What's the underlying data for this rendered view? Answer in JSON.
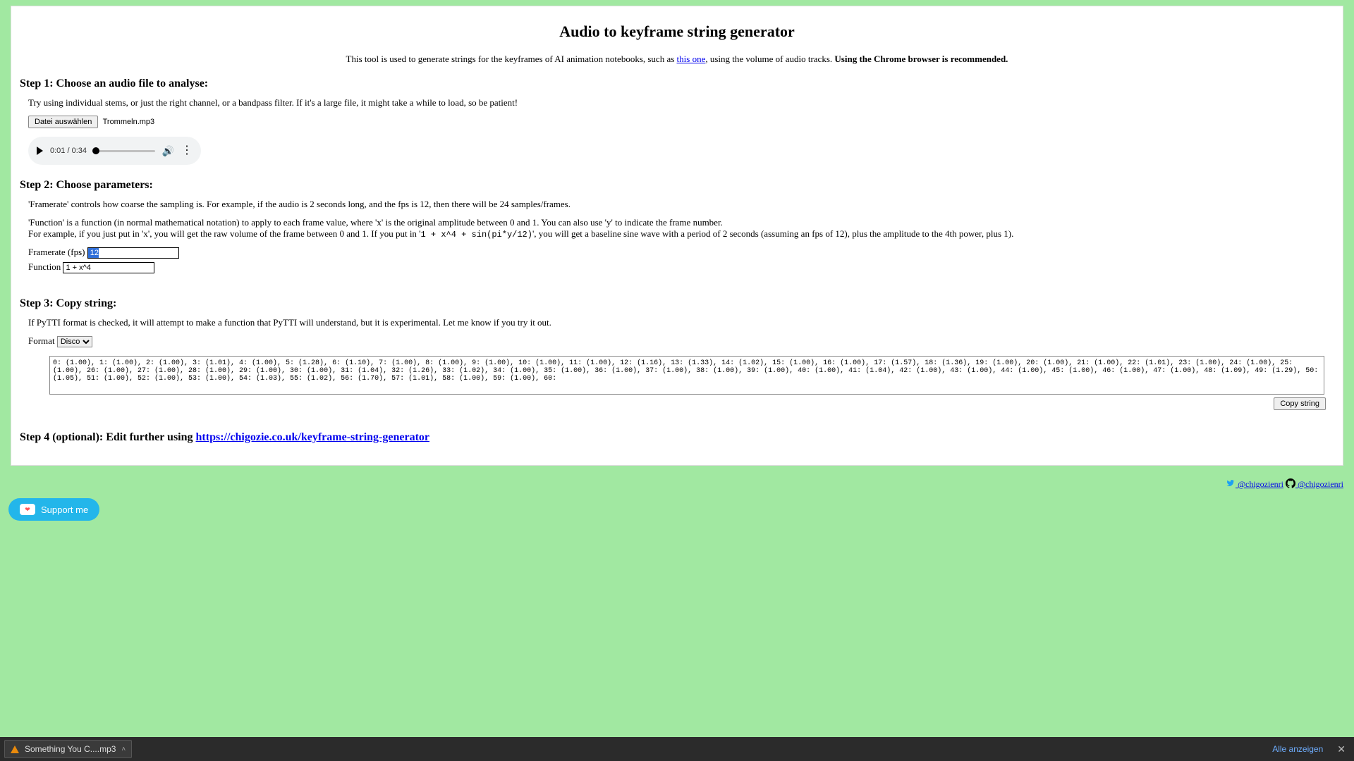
{
  "title": "Audio to keyframe string generator",
  "subtitle_pre": "This tool is used to generate strings for the keyframes of AI animation notebooks, such as ",
  "subtitle_link": "this one",
  "subtitle_post": ", using the volume of audio tracks. ",
  "subtitle_bold": "Using the Chrome browser is recommended.",
  "step1": {
    "heading": "Step 1: Choose an audio file to analyse:",
    "note": "Try using individual stems, or just the right channel, or a bandpass filter. If it's a large file, it might take a while to load, so be patient!",
    "file_button": "Datei auswählen",
    "file_name": "Trommeln.mp3",
    "audio_time": "0:01 / 0:34"
  },
  "step2": {
    "heading": "Step 2: Choose parameters:",
    "p1": "'Framerate' controls how coarse the sampling is. For example, if the audio is 2 seconds long, and the fps is 12, then there will be 24 samples/frames.",
    "p2a": "'Function' is a function (in normal mathematical notation) to apply to each frame value, where 'x' is the original amplitude between 0 and 1. You can also use 'y' to indicate the frame number.",
    "p2b_pre": "For example, if you just put in 'x', you will get the raw volume of the frame between 0 and 1. If you put in '",
    "p2b_code": "1 + x^4 + sin(pi*y/12)",
    "p2b_post": "', you will get a baseline sine wave with a period of 2 seconds (assuming an fps of 12), plus the amplitude to the 4th power, plus 1).",
    "fps_label": "Framerate (fps)",
    "fps_value": "12",
    "fn_label": "Function",
    "fn_value": "1 + x^4"
  },
  "step3": {
    "heading": "Step 3: Copy string:",
    "note": "If PyTTI format is checked, it will attempt to make a function that PyTTI will understand, but it is experimental. Let me know if you try it out.",
    "format_label": "Format",
    "format_value": "Disco",
    "output": "0: (1.00), 1: (1.00), 2: (1.00), 3: (1.01), 4: (1.00), 5: (1.28), 6: (1.10), 7: (1.00), 8: (1.00), 9: (1.00), 10: (1.00), 11: (1.00), 12: (1.16), 13: (1.33), 14: (1.02), 15: (1.00), 16: (1.00), 17: (1.57), 18: (1.36), 19: (1.00), 20: (1.00), 21: (1.00), 22: (1.01), 23: (1.00), 24: (1.00), 25: (1.00), 26: (1.00), 27: (1.00), 28: (1.00), 29: (1.00), 30: (1.00), 31: (1.04), 32: (1.26), 33: (1.02), 34: (1.00), 35: (1.00), 36: (1.00), 37: (1.00), 38: (1.00), 39: (1.00), 40: (1.00), 41: (1.04), 42: (1.00), 43: (1.00), 44: (1.00), 45: (1.00), 46: (1.00), 47: (1.00), 48: (1.09), 49: (1.29), 50: (1.05), 51: (1.00), 52: (1.00), 53: (1.00), 54: (1.03), 55: (1.02), 56: (1.70), 57: (1.01), 58: (1.00), 59: (1.00), 60:",
    "copy_btn": "Copy string"
  },
  "step4": {
    "heading_pre": "Step 4 (optional): Edit further using ",
    "link": "https://chigozie.co.uk/keyframe-string-generator"
  },
  "footer": {
    "twitter": " @chigozienri",
    "github": " @chigozienri"
  },
  "support_btn": "Support me",
  "download_bar": {
    "file": "Something You C....mp3",
    "show_all": "Alle anzeigen"
  }
}
